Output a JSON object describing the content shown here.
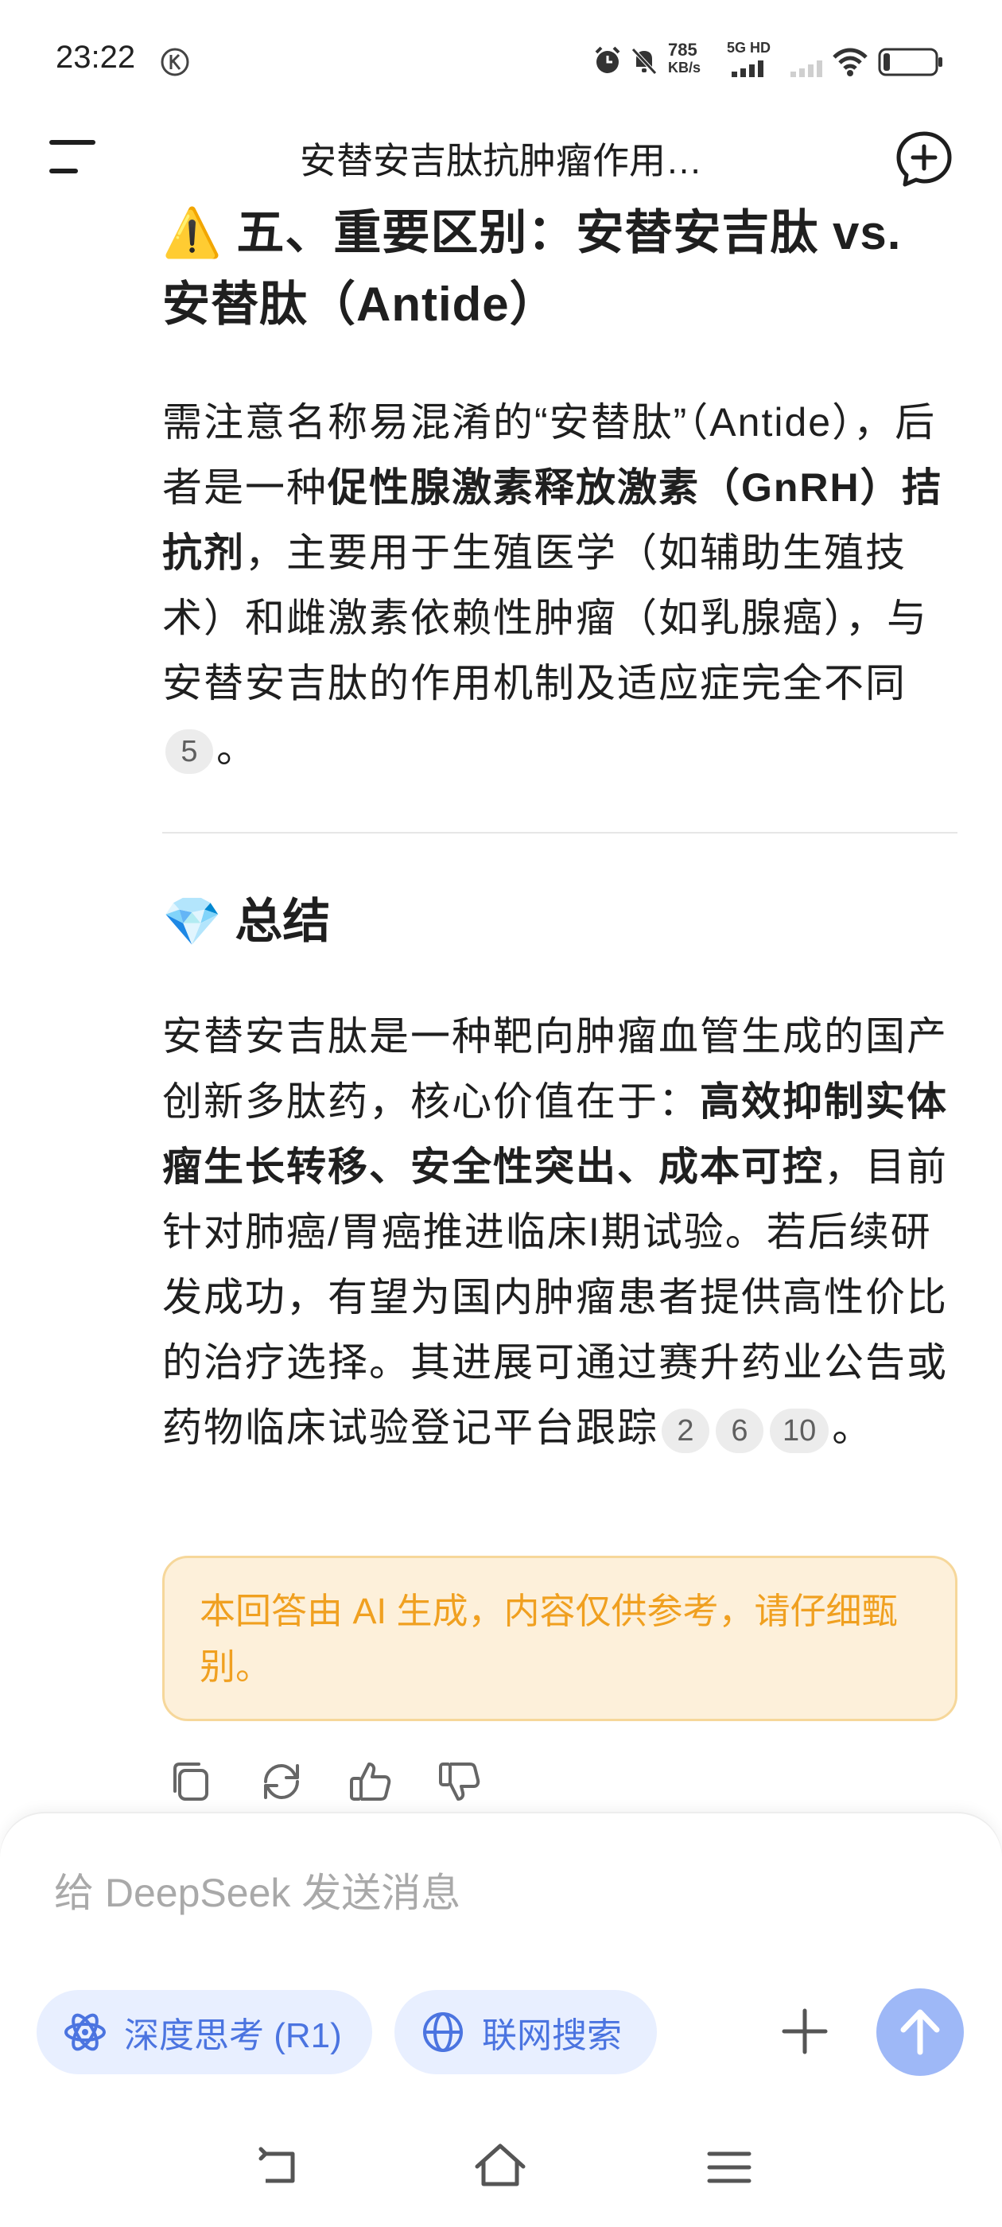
{
  "status_bar": {
    "time": "23:22",
    "speed_value": "785",
    "speed_unit": "KB/s",
    "network": "5G HD",
    "icons": [
      "k-badge-icon",
      "alarm-icon",
      "mute-icon",
      "signal-icon",
      "wifi-icon",
      "battery-icon"
    ]
  },
  "header": {
    "title": "安替安吉肽抗肿瘤作用…",
    "menu_icon": "menu-icon",
    "new_chat_icon": "new-chat-icon"
  },
  "content": {
    "section5": {
      "emoji": "⚠️",
      "heading_line1": "五、重要区别：安替安吉肽 vs.",
      "heading_line2": "安替肽（Antide）"
    },
    "para1": {
      "t1": "需注意名称易混淆的“安替肽”（Antide），后者是一种",
      "b1": "促性腺激素释放激素（GnRH）拮抗剂",
      "t2": "，主要用于生殖医学（如辅助生殖技术）和雌激素依赖性肿瘤（如乳腺癌），与安替安吉肽的作用机制及适应症完全不同",
      "cite1": "5",
      "end": "。"
    },
    "summary": {
      "emoji": "💎",
      "heading": "总结"
    },
    "para2": {
      "t1": "安替安吉肽是一种靶向肿瘤血管生成的国产创新多肽药，核心价值在于：",
      "b1": "高效抑制实体瘤生长转移、安全性突出、成本可控",
      "t2": "，目前针对肺癌/胃癌推进临床I期试验。若后续研发成功，有望为国内肿瘤患者提供高性价比的治疗选择。其进展可通过赛升药业公告或药物临床试验登记平台跟踪",
      "cite1": "2",
      "cite2": "6",
      "cite3": "10",
      "end": "。"
    },
    "notice": "本回答由 AI 生成，内容仅供参考，请仔细甄别。",
    "actions": [
      "copy-icon",
      "regenerate-icon",
      "thumbs-up-icon",
      "thumbs-down-icon"
    ]
  },
  "composer": {
    "placeholder": "给 DeepSeek 发送消息",
    "deepthink_label": "深度思考 (R1)",
    "search_label": "联网搜索"
  },
  "colors": {
    "accent": "#4b74e0",
    "pill_bg": "#e8efff",
    "send_bg": "#9eb8f7",
    "notice_bg": "#fdf0da",
    "notice_border": "#f6d79a",
    "notice_text": "#f0a020"
  }
}
